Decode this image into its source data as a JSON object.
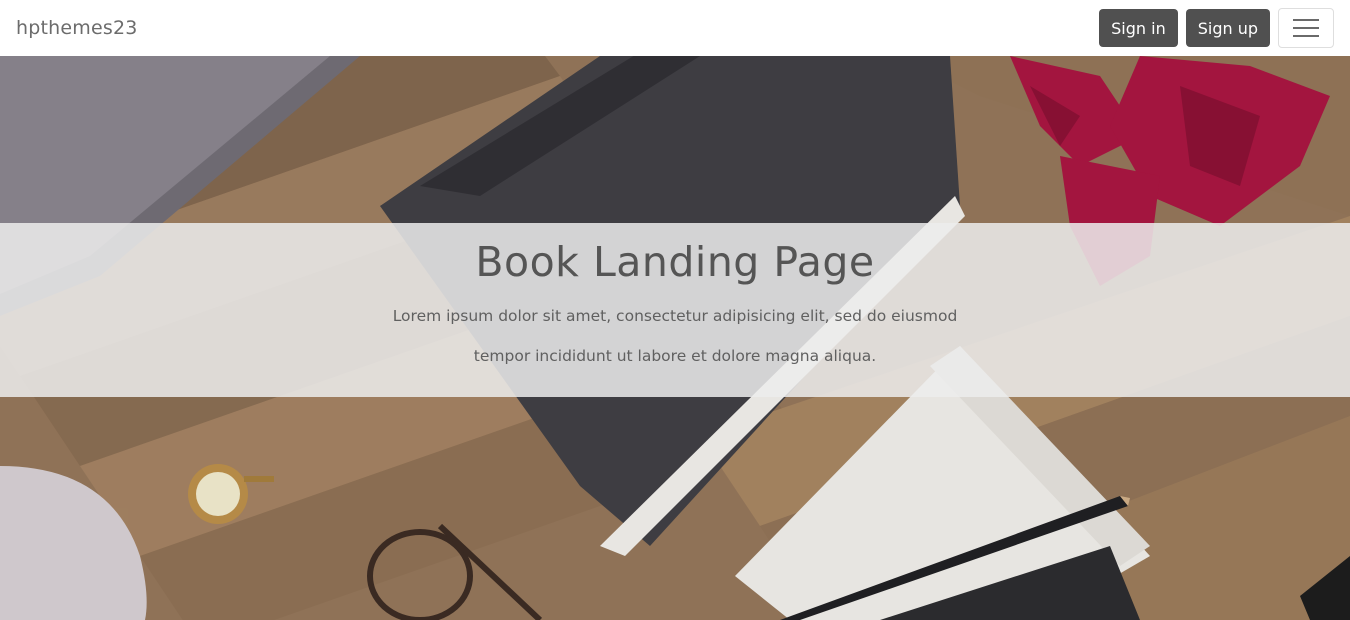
{
  "navbar": {
    "brand": "hpthemes23",
    "sign_in_label": "Sign in",
    "sign_up_label": "Sign up",
    "toggler_icon": "hamburger-menu-icon"
  },
  "hero": {
    "title": "Book Landing Page",
    "text": "Lorem ipsum dolor sit amet, consectetur adipisicing elit, sed do eiusmod tempor incididunt ut labore et dolore magna aliqua.",
    "band_color": "#ececec"
  },
  "colors": {
    "button_bg": "#505050",
    "brand_text": "#6c6c6c",
    "title_text": "#555555"
  }
}
